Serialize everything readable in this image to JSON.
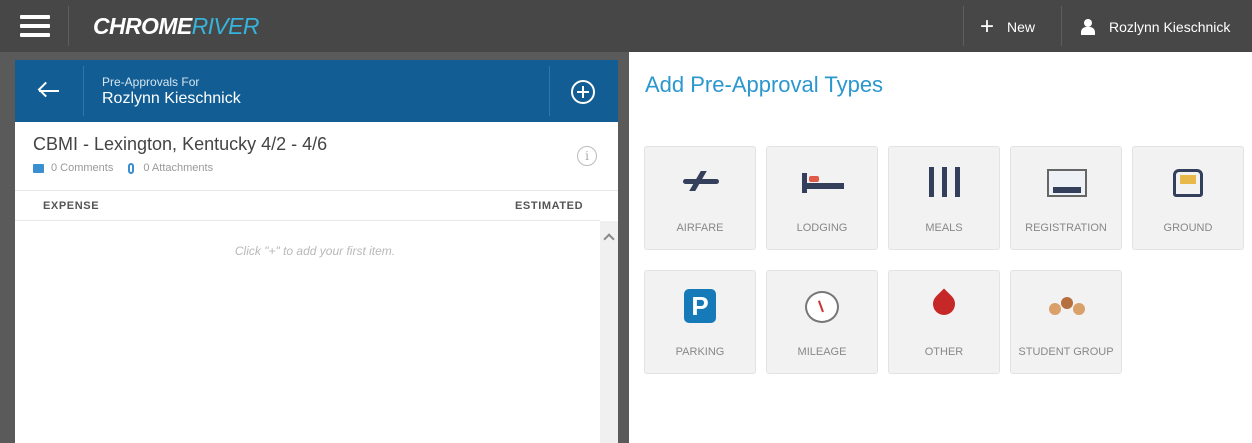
{
  "topbar": {
    "logo_part1": "CHROME",
    "logo_part2": "RIVER",
    "new_label": "New",
    "new_icon": "plus-icon",
    "user_name": "Rozlynn Kieschnick",
    "user_icon": "user-icon"
  },
  "left": {
    "header_sub": "Pre-Approvals For",
    "header_name": "Rozlynn Kieschnick",
    "report_title": "CBMI - Lexington, Kentucky 4/2 - 4/6",
    "comments": "0 Comments",
    "attachments": "0 Attachments",
    "col_expense": "EXPENSE",
    "col_estimated": "ESTIMATED",
    "empty_message": "Click \"+\" to add your first item."
  },
  "right": {
    "title": "Add Pre-Approval Types",
    "tiles": [
      {
        "label": "AIRFARE",
        "icon": "airplane-icon"
      },
      {
        "label": "LODGING",
        "icon": "bed-icon"
      },
      {
        "label": "MEALS",
        "icon": "utensils-icon"
      },
      {
        "label": "REGISTRATION",
        "icon": "registration-icon"
      },
      {
        "label": "GROUND",
        "icon": "car-icon"
      },
      {
        "label": "PARKING",
        "icon": "parking-icon"
      },
      {
        "label": "MILEAGE",
        "icon": "gauge-icon"
      },
      {
        "label": "OTHER",
        "icon": "drop-icon"
      },
      {
        "label": "STUDENT GROUP",
        "icon": "group-icon"
      }
    ]
  },
  "colors": {
    "topbar": "#474747",
    "header_blue": "#125e94",
    "accent": "#2b97cf",
    "logo_river": "#35b4de"
  }
}
